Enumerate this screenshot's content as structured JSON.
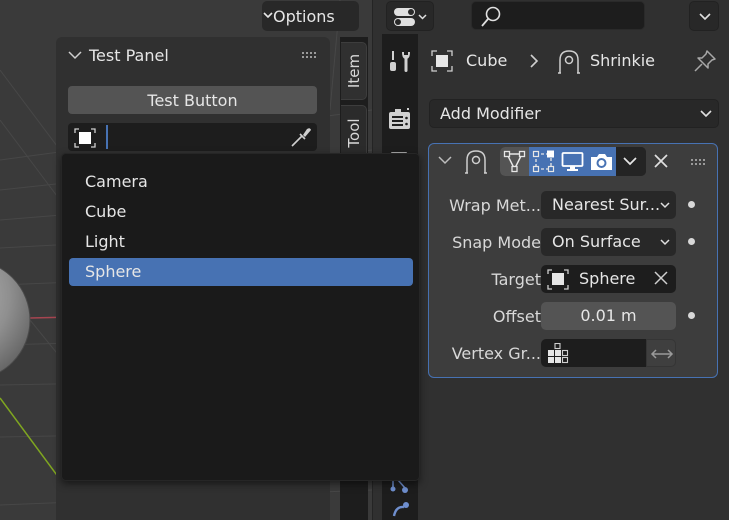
{
  "viewport": {
    "options_label": "Options",
    "axis_colors": {
      "x": "#a64550",
      "y": "#7fa620"
    }
  },
  "npanel": {
    "title": "Test Panel",
    "test_button_label": "Test Button",
    "object_field_value": ""
  },
  "sidebar_tabs": [
    {
      "label": "Item",
      "active": true
    },
    {
      "label": "Tool",
      "active": false
    }
  ],
  "properties": {
    "search_placeholder": "",
    "breadcrumb": {
      "object": "Cube",
      "modifier": "Shrinkie"
    },
    "add_modifier_label": "Add Modifier",
    "modifier": {
      "name": "Shrinkie",
      "toggles": {
        "on_cage": false,
        "edit_mode": true,
        "viewport": true,
        "render": true
      },
      "rows": [
        {
          "label": "Wrap Met...",
          "value": "Nearest Sur..."
        },
        {
          "label": "Snap Mode",
          "value": "On Surface"
        },
        {
          "label": "Target",
          "value": "Sphere"
        },
        {
          "label": "Offset",
          "value": "0.01 m"
        },
        {
          "label": "Vertex Gr...",
          "value": ""
        }
      ]
    }
  },
  "popup": {
    "items": [
      {
        "label": "Camera",
        "selected": false
      },
      {
        "label": "Cube",
        "selected": false
      },
      {
        "label": "Light",
        "selected": false
      },
      {
        "label": "Sphere",
        "selected": true
      }
    ]
  },
  "colors": {
    "accent": "#4772b3",
    "panel_bg": "#303030",
    "field_bg": "#1d1d1d",
    "popup_bg": "#1a1a1a"
  }
}
